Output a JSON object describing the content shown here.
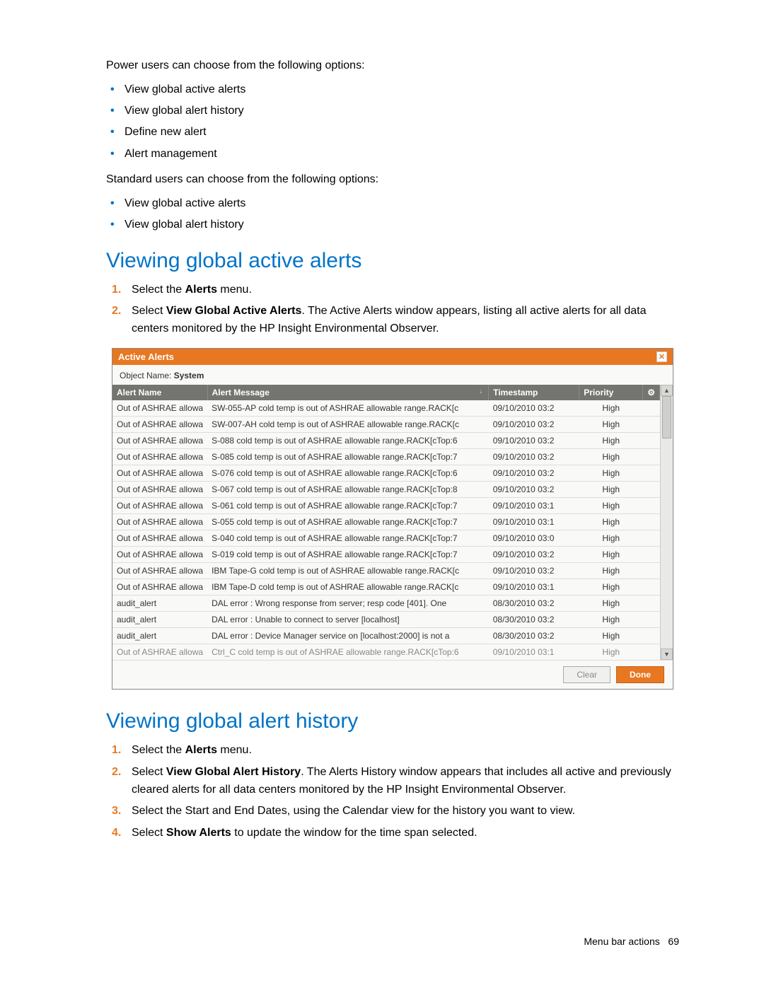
{
  "intro": {
    "power_text": "Power users can choose from the following options:",
    "power_items": [
      "View global active alerts",
      "View global alert history",
      "Define new alert",
      "Alert management"
    ],
    "standard_text": "Standard users can choose from the following options:",
    "standard_items": [
      "View global active alerts",
      "View global alert history"
    ]
  },
  "section1": {
    "heading": "Viewing global active alerts",
    "step1_a": "Select the ",
    "step1_b": "Alerts",
    "step1_c": " menu.",
    "step2_a": "Select ",
    "step2_b": "View Global Active Alerts",
    "step2_c": ". The Active Alerts window appears, listing all active alerts for all data centers monitored by the HP Insight Environmental Observer."
  },
  "dialog": {
    "title": "Active Alerts",
    "object_label": "Object Name:",
    "object_value": "System",
    "columns": {
      "name": "Alert Name",
      "msg": "Alert Message",
      "ts": "Timestamp",
      "pri": "Priority"
    },
    "rows": [
      {
        "name": "Out of ASHRAE allowa",
        "msg": "SW-055-AP cold temp is out of ASHRAE allowable range.RACK[c",
        "ts": "09/10/2010 03:2",
        "pri": "High"
      },
      {
        "name": "Out of ASHRAE allowa",
        "msg": "SW-007-AH cold temp is out of ASHRAE allowable range.RACK[c",
        "ts": "09/10/2010 03:2",
        "pri": "High"
      },
      {
        "name": "Out of ASHRAE allowa",
        "msg": "S-088 cold temp is out of ASHRAE allowable range.RACK[cTop:6",
        "ts": "09/10/2010 03:2",
        "pri": "High"
      },
      {
        "name": "Out of ASHRAE allowa",
        "msg": "S-085 cold temp is out of ASHRAE allowable range.RACK[cTop:7",
        "ts": "09/10/2010 03:2",
        "pri": "High"
      },
      {
        "name": "Out of ASHRAE allowa",
        "msg": "S-076 cold temp is out of ASHRAE allowable range.RACK[cTop:6",
        "ts": "09/10/2010 03:2",
        "pri": "High"
      },
      {
        "name": "Out of ASHRAE allowa",
        "msg": "S-067 cold temp is out of ASHRAE allowable range.RACK[cTop:8",
        "ts": "09/10/2010 03:2",
        "pri": "High"
      },
      {
        "name": "Out of ASHRAE allowa",
        "msg": "S-061 cold temp is out of ASHRAE allowable range.RACK[cTop:7",
        "ts": "09/10/2010 03:1",
        "pri": "High"
      },
      {
        "name": "Out of ASHRAE allowa",
        "msg": "S-055 cold temp is out of ASHRAE allowable range.RACK[cTop:7",
        "ts": "09/10/2010 03:1",
        "pri": "High"
      },
      {
        "name": "Out of ASHRAE allowa",
        "msg": "S-040 cold temp is out of ASHRAE allowable range.RACK[cTop:7",
        "ts": "09/10/2010 03:0",
        "pri": "High"
      },
      {
        "name": "Out of ASHRAE allowa",
        "msg": "S-019 cold temp is out of ASHRAE allowable range.RACK[cTop:7",
        "ts": "09/10/2010 03:2",
        "pri": "High"
      },
      {
        "name": "Out of ASHRAE allowa",
        "msg": "IBM Tape-G cold temp is out of ASHRAE allowable range.RACK[c",
        "ts": "09/10/2010 03:2",
        "pri": "High"
      },
      {
        "name": "Out of ASHRAE allowa",
        "msg": "IBM Tape-D cold temp is out of ASHRAE allowable range.RACK[c",
        "ts": "09/10/2010 03:1",
        "pri": "High"
      },
      {
        "name": "audit_alert",
        "msg": "DAL error : Wrong response from server; resp code [401]. One",
        "ts": "08/30/2010 03:2",
        "pri": "High"
      },
      {
        "name": "audit_alert",
        "msg": "DAL error : Unable to connect to server [localhost]",
        "ts": "08/30/2010 03:2",
        "pri": "High"
      },
      {
        "name": "audit_alert",
        "msg": "DAL error : Device Manager service on [localhost:2000] is not a",
        "ts": "08/30/2010 03:2",
        "pri": "High"
      }
    ],
    "cutoff_row": {
      "name": "Out of ASHRAE allowa",
      "msg": "Ctrl_C cold temp is out of ASHRAE allowable range.RACK[cTop:6",
      "ts": "09/10/2010 03:1",
      "pri": "High"
    },
    "clear_btn": "Clear",
    "done_btn": "Done"
  },
  "section2": {
    "heading": "Viewing global alert history",
    "step1_a": "Select the ",
    "step1_b": "Alerts",
    "step1_c": " menu.",
    "step2_a": "Select ",
    "step2_b": "View Global Alert History",
    "step2_c": ". The Alerts History window appears that includes all active and previously cleared alerts for all data centers monitored by the HP Insight Environmental Observer.",
    "step3": "Select the Start and End Dates, using the Calendar view for the history you want to view.",
    "step4_a": "Select ",
    "step4_b": "Show Alerts",
    "step4_c": " to update the window for the time span selected."
  },
  "footer": {
    "text": "Menu bar actions",
    "page": "69"
  }
}
